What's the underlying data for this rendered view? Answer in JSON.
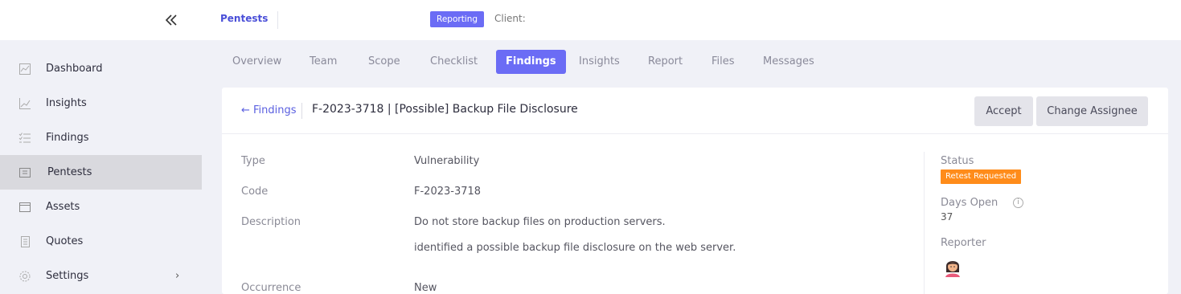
{
  "header": {
    "project": "Pentests",
    "badge": "Reporting",
    "client_label": "Client:"
  },
  "sidebar": {
    "items": [
      {
        "label": "Dashboard",
        "icon": "chart-icon"
      },
      {
        "label": "Insights",
        "icon": "line-chart-icon"
      },
      {
        "label": "Findings",
        "icon": "list-icon"
      },
      {
        "label": "Pentests",
        "icon": "folder-icon",
        "active": true
      },
      {
        "label": "Assets",
        "icon": "box-icon"
      },
      {
        "label": "Quotes",
        "icon": "document-icon"
      },
      {
        "label": "Settings",
        "icon": "gear-icon",
        "chevron": "›"
      }
    ]
  },
  "tabs": [
    {
      "label": "Overview"
    },
    {
      "label": "Team"
    },
    {
      "label": "Scope"
    },
    {
      "label": "Checklist"
    },
    {
      "label": "Findings",
      "active": true
    },
    {
      "label": "Insights"
    },
    {
      "label": "Report"
    },
    {
      "label": "Files"
    },
    {
      "label": "Messages"
    }
  ],
  "finding": {
    "back_label": "← Findings",
    "title": "F-2023-3718 | [Possible] Backup File Disclosure",
    "accept_label": "Accept",
    "change_assignee_label": "Change Assignee",
    "fields": {
      "type_label": "Type",
      "type_value": "Vulnerability",
      "code_label": "Code",
      "code_value": "F-2023-3718",
      "description_label": "Description",
      "description_line1": "Do not store backup files on production servers.",
      "description_line2": "identified a possible backup file disclosure on the web server.",
      "occurrence_label": "Occurrence",
      "occurrence_value": "New"
    },
    "meta": {
      "status_label": "Status",
      "status_value": "Retest Requested",
      "days_open_label": "Days Open",
      "days_open_value": "37",
      "info_glyph": "i",
      "reporter_label": "Reporter"
    }
  },
  "colors": {
    "accent": "#6b6cf5",
    "status": "#ff8c1a"
  }
}
